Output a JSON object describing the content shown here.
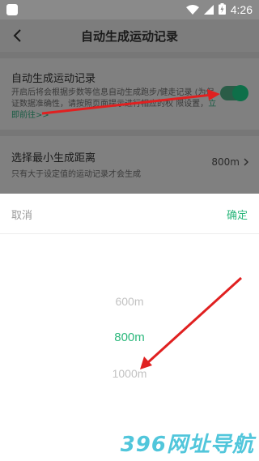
{
  "status_bar": {
    "time": "4:26"
  },
  "header": {
    "title": "自动生成运动记录"
  },
  "auto_record": {
    "title": "自动生成运动记录",
    "desc_line1": "开启后将会根据步数等信息自动生成跑步/健走记录",
    "desc_line2": "(为保证数据准确性，请按照页面提示进行相应的权",
    "desc_line3_prefix": "限设置，",
    "link": "立即前往>>",
    "toggle_on": true
  },
  "min_distance": {
    "title": "选择最小生成距离",
    "desc": "只有大于设定值的运动记录才会生成",
    "value": "800m"
  },
  "picker": {
    "cancel_label": "取消",
    "confirm_label": "确定",
    "options": [
      "600m",
      "800m",
      "1000m"
    ],
    "selected": "800m"
  },
  "watermark": "396网址导航",
  "colors": {
    "accent": "#29b67a",
    "arrow": "#e02020",
    "watermark": "#3fc0d8"
  }
}
